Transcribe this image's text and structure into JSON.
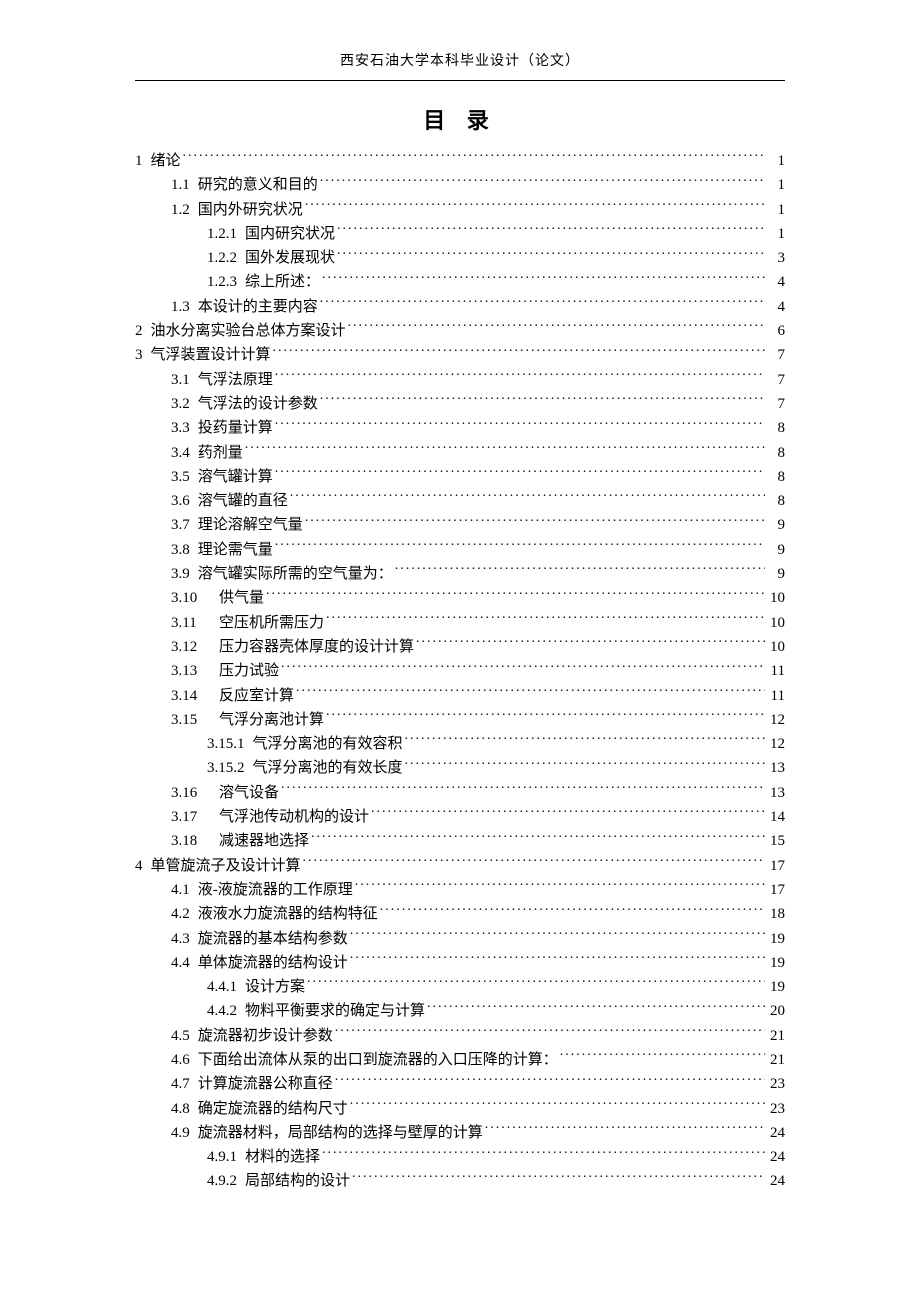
{
  "header": "西安石油大学本科毕业设计（论文）",
  "title": "目 录",
  "toc": [
    {
      "level": 1,
      "num": "1",
      "label": "绪论",
      "page": "1"
    },
    {
      "level": 2,
      "num": "1.1",
      "label": "研究的意义和目的",
      "page": "1"
    },
    {
      "level": 2,
      "num": "1.2",
      "label": "国内外研究状况",
      "page": "1"
    },
    {
      "level": 3,
      "num": "1.2.1",
      "label": "国内研究状况",
      "page": "1"
    },
    {
      "level": 3,
      "num": "1.2.2",
      "label": "国外发展现状",
      "page": "3"
    },
    {
      "level": 3,
      "num": "1.2.3",
      "label": "综上所述：",
      "page": "4"
    },
    {
      "level": 2,
      "num": "1.3",
      "label": "本设计的主要内容",
      "page": "4"
    },
    {
      "level": 1,
      "num": "2",
      "label": "油水分离实验台总体方案设计",
      "page": "6"
    },
    {
      "level": 1,
      "num": "3",
      "label": "气浮装置设计计算",
      "page": "7"
    },
    {
      "level": 2,
      "num": "3.1",
      "label": "气浮法原理",
      "page": "7"
    },
    {
      "level": 2,
      "num": "3.2",
      "label": "气浮法的设计参数",
      "page": "7"
    },
    {
      "level": 2,
      "num": "3.3",
      "label": "投药量计算",
      "page": "8"
    },
    {
      "level": 2,
      "num": "3.4",
      "label": "药剂量",
      "page": "8"
    },
    {
      "level": 2,
      "num": "3.5",
      "label": "溶气罐计算",
      "page": "8"
    },
    {
      "level": 2,
      "num": "3.6",
      "label": "溶气罐的直径",
      "page": "8"
    },
    {
      "level": 2,
      "num": "3.7",
      "label": "理论溶解空气量",
      "page": "9"
    },
    {
      "level": 2,
      "num": "3.8",
      "label": "理论需气量",
      "page": "9"
    },
    {
      "level": 2,
      "num": "3.9",
      "label": "溶气罐实际所需的空气量为：",
      "page": "9"
    },
    {
      "level": 2,
      "num": "3.10",
      "label": "供气量",
      "page": "10"
    },
    {
      "level": 2,
      "num": "3.11",
      "label": "空压机所需压力",
      "page": "10"
    },
    {
      "level": 2,
      "num": "3.12",
      "label": "压力容器壳体厚度的设计计算",
      "page": "10"
    },
    {
      "level": 2,
      "num": "3.13",
      "label": "压力试验",
      "page": "11"
    },
    {
      "level": 2,
      "num": "3.14",
      "label": "反应室计算",
      "page": "11"
    },
    {
      "level": 2,
      "num": "3.15",
      "label": "气浮分离池计算",
      "page": "12"
    },
    {
      "level": 3,
      "num": "3.15.1",
      "label": "气浮分离池的有效容积",
      "page": "12"
    },
    {
      "level": 3,
      "num": "3.15.2",
      "label": "气浮分离池的有效长度",
      "page": "13"
    },
    {
      "level": 2,
      "num": "3.16",
      "label": "溶气设备",
      "page": "13"
    },
    {
      "level": 2,
      "num": "3.17",
      "label": "气浮池传动机构的设计",
      "page": "14"
    },
    {
      "level": 2,
      "num": "3.18",
      "label": "减速器地选择",
      "page": "15"
    },
    {
      "level": 1,
      "num": "4",
      "label": "单管旋流子及设计计算",
      "page": "17"
    },
    {
      "level": 2,
      "num": "4.1",
      "label": "液-液旋流器的工作原理",
      "page": "17"
    },
    {
      "level": 2,
      "num": "4.2",
      "label": "液液水力旋流器的结构特征",
      "page": "18"
    },
    {
      "level": 2,
      "num": "4.3",
      "label": "旋流器的基本结构参数",
      "page": "19"
    },
    {
      "level": 2,
      "num": "4.4",
      "label": "单体旋流器的结构设计",
      "page": "19"
    },
    {
      "level": 3,
      "num": "4.4.1",
      "label": "设计方案",
      "page": "19"
    },
    {
      "level": 3,
      "num": "4.4.2",
      "label": "物料平衡要求的确定与计算",
      "page": "20"
    },
    {
      "level": 2,
      "num": "4.5",
      "label": "旋流器初步设计参数",
      "page": "21"
    },
    {
      "level": 2,
      "num": "4.6",
      "label": "下面给出流体从泵的出口到旋流器的入口压降的计算：",
      "page": "21"
    },
    {
      "level": 2,
      "num": "4.7",
      "label": "计算旋流器公称直径",
      "page": "23"
    },
    {
      "level": 2,
      "num": "4.8",
      "label": "确定旋流器的结构尺寸",
      "page": "23"
    },
    {
      "level": 2,
      "num": "4.9",
      "label": "旋流器材料，局部结构的选择与壁厚的计算",
      "page": "24"
    },
    {
      "level": 3,
      "num": "4.9.1",
      "label": "材料的选择",
      "page": "24"
    },
    {
      "level": 3,
      "num": "4.9.2",
      "label": "局部结构的设计",
      "page": "24"
    }
  ]
}
